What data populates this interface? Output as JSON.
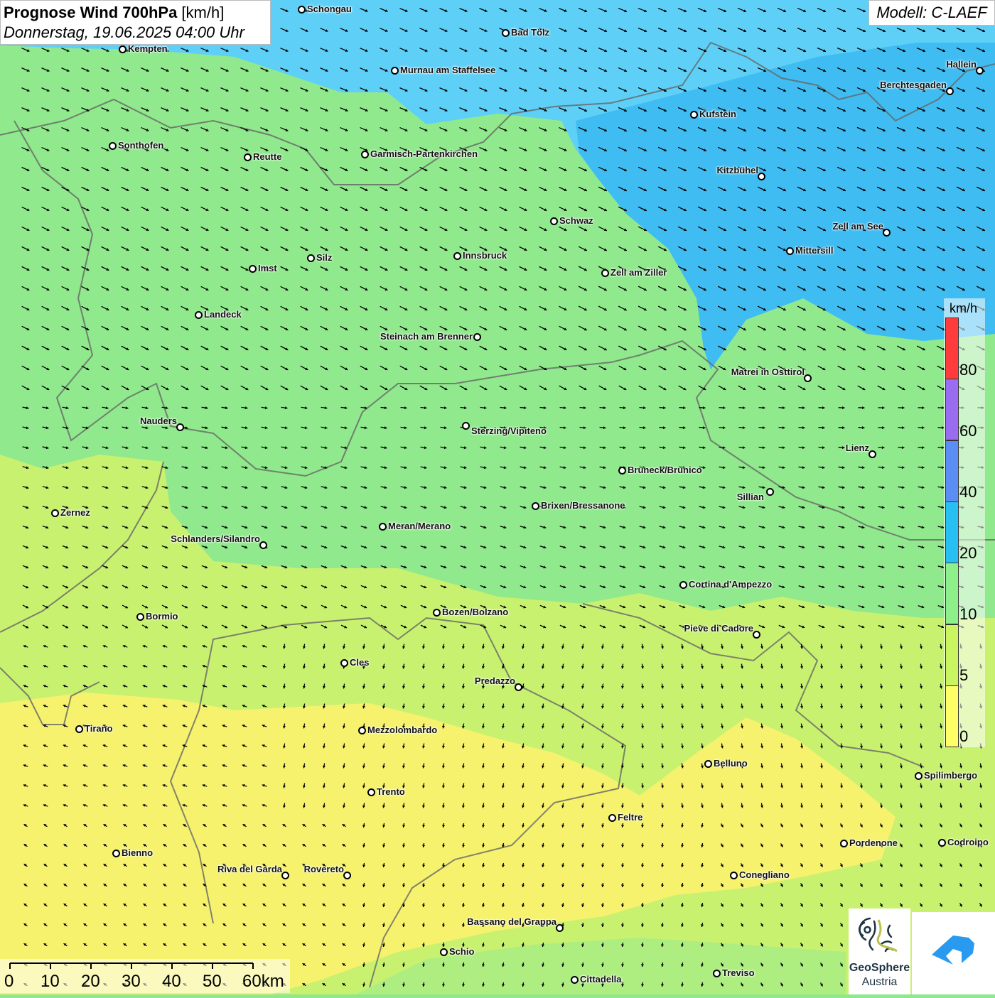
{
  "header": {
    "title_bold": "Prognose Wind 700hPa",
    "title_unit": " [km/h]",
    "subtitle": "Donnerstag, 19.06.2025 04:00 Uhr",
    "model": "Modell: C-LAEF"
  },
  "legend": {
    "unit": "km/h",
    "ticks": [
      "80",
      "60",
      "40",
      "20",
      "10",
      "5",
      "0"
    ],
    "colors": [
      "#ff3b3b",
      "#9a6cf2",
      "#5b8ef5",
      "#27c0f5",
      "#8ef08a",
      "#c8f560",
      "#ffff66"
    ]
  },
  "scale_bar": {
    "labels": [
      "0",
      "10",
      "20",
      "30",
      "40",
      "50",
      "60km"
    ]
  },
  "logos": {
    "geosphere_line1": "GeoSphere",
    "geosphere_line2": "Austria"
  },
  "zone_colors": {
    "blue_light": "#5ed0f7",
    "blue_dark": "#3fbdf2",
    "green": "#90e98c",
    "yellowgreen": "#c9f170",
    "yellow": "#f6f26e"
  },
  "cities": [
    "Schongau",
    "Bad Tölz",
    "Kempten",
    "Murnau am Staffelsee",
    "Hallein",
    "Berchtesgaden",
    "Kufstein",
    "Sonthofen",
    "Reutte",
    "Garmisch-Partenkirchen",
    "Kitzbühel",
    "Schwaz",
    "Zell am See",
    "Innsbruck",
    "Silz",
    "Mittersill",
    "Imst",
    "Zell am Ziller",
    "Landeck",
    "Steinach am Brenner",
    "Matrei in Osttirol",
    "Nauders",
    "Sterzing/Vipiteno",
    "Lienz",
    "Bruneck/Brunico",
    "Sillian",
    "Brixen/Bressanone",
    "Zernez",
    "Meran/Merano",
    "Schlanders/Silandro",
    "Cortina d'Ampezzo",
    "Bozen/Bolzano",
    "Bormio",
    "Pieve di Cadore",
    "Cles",
    "Predazzo",
    "Tirano",
    "Mezzolombardo",
    "Belluno",
    "Spilimbergo",
    "Trento",
    "Feltre",
    "Pordenone",
    "Codroipo",
    "Bienno",
    "Riva del Garda",
    "Rovereto",
    "Conegliano",
    "Bassano del Grappa",
    "Schio",
    "Treviso",
    "Cittadella"
  ]
}
